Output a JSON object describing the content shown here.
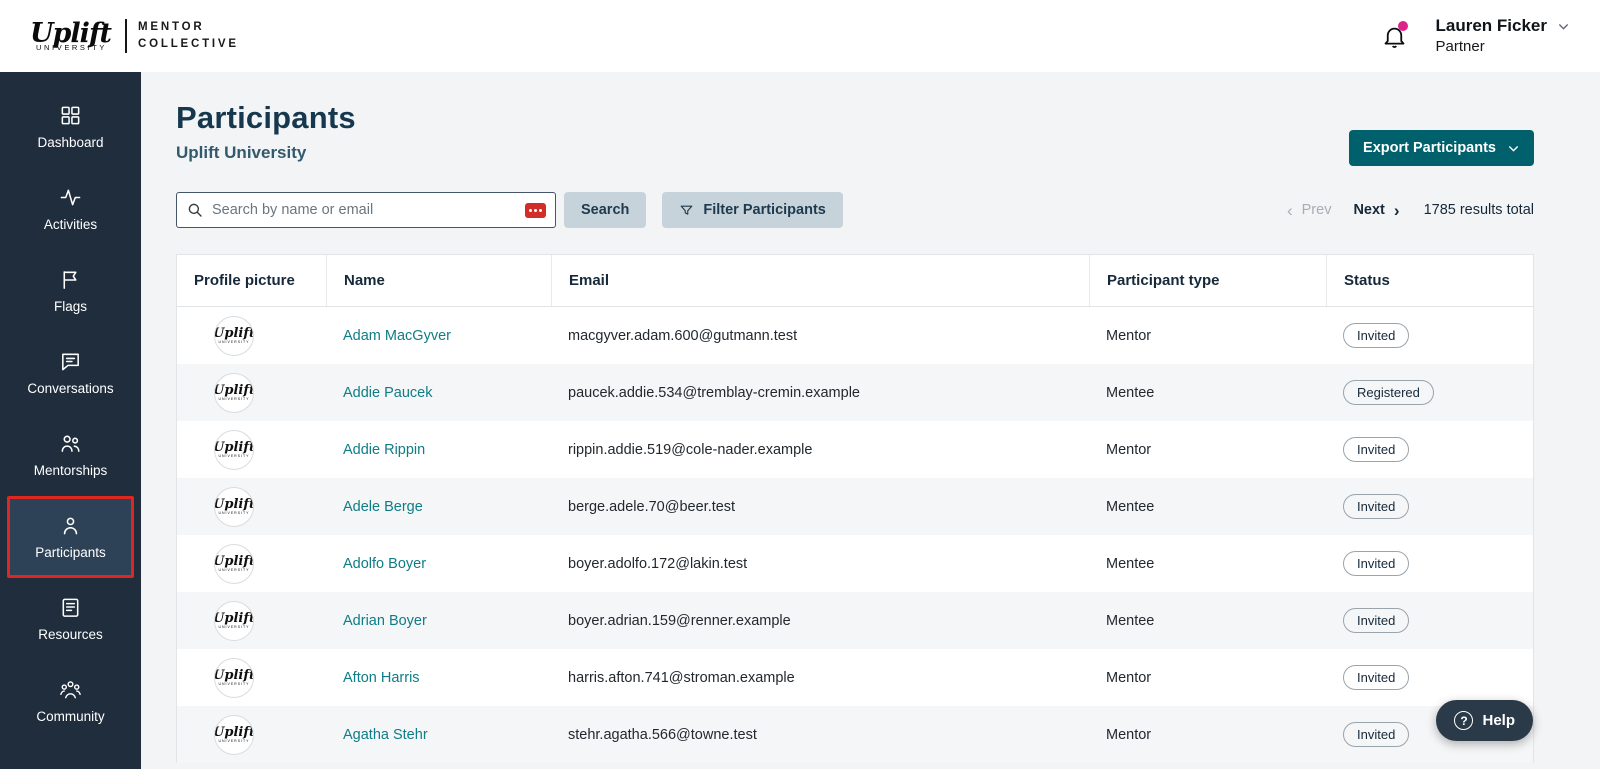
{
  "colors": {
    "sidebar_bg": "#1f2d3d",
    "sidebar_active_bg": "#2d4256",
    "annotation_red": "#df2721",
    "accent_teal": "#00616d",
    "link_teal": "#0e7d85",
    "notification_dot": "#e0218a",
    "title_navy": "#16384e"
  },
  "header": {
    "logo": {
      "brand": "Uplift",
      "brand_sub": "UNIVERSITY",
      "mentor_line1": "MENTOR",
      "mentor_line2": "COLLECTIVE"
    },
    "user": {
      "name": "Lauren Ficker",
      "role": "Partner"
    }
  },
  "sidebar": {
    "items": [
      {
        "label": "Dashboard",
        "icon": "dashboard-icon",
        "active": false
      },
      {
        "label": "Activities",
        "icon": "activities-icon",
        "active": false
      },
      {
        "label": "Flags",
        "icon": "flag-icon",
        "active": false
      },
      {
        "label": "Conversations",
        "icon": "conversations-icon",
        "active": false
      },
      {
        "label": "Mentorships",
        "icon": "mentorships-icon",
        "active": false
      },
      {
        "label": "Participants",
        "icon": "participants-icon",
        "active": true
      },
      {
        "label": "Resources",
        "icon": "resources-icon",
        "active": false
      },
      {
        "label": "Community",
        "icon": "community-icon",
        "active": false
      }
    ]
  },
  "avatar": {
    "brand": "Uplift",
    "sub": "UNIVERSITY"
  },
  "main": {
    "title": "Participants",
    "subtitle": "Uplift University",
    "export_label": "Export Participants",
    "search": {
      "placeholder": "Search by name or email",
      "search_label": "Search",
      "filter_label": "Filter Participants"
    },
    "pagination": {
      "prev_label": "Prev",
      "next_label": "Next",
      "total_label": "1785 results total"
    },
    "table": {
      "columns": [
        "Profile picture",
        "Name",
        "Email",
        "Participant type",
        "Status"
      ],
      "rows": [
        {
          "name": "Adam MacGyver",
          "email": "macgyver.adam.600@gutmann.test",
          "type": "Mentor",
          "status": "Invited"
        },
        {
          "name": "Addie Paucek",
          "email": "paucek.addie.534@tremblay-cremin.example",
          "type": "Mentee",
          "status": "Registered"
        },
        {
          "name": "Addie Rippin",
          "email": "rippin.addie.519@cole-nader.example",
          "type": "Mentor",
          "status": "Invited"
        },
        {
          "name": "Adele Berge",
          "email": "berge.adele.70@beer.test",
          "type": "Mentee",
          "status": "Invited"
        },
        {
          "name": "Adolfo Boyer",
          "email": "boyer.adolfo.172@lakin.test",
          "type": "Mentee",
          "status": "Invited"
        },
        {
          "name": "Adrian Boyer",
          "email": "boyer.adrian.159@renner.example",
          "type": "Mentee",
          "status": "Invited"
        },
        {
          "name": "Afton Harris",
          "email": "harris.afton.741@stroman.example",
          "type": "Mentor",
          "status": "Invited"
        },
        {
          "name": "Agatha Stehr",
          "email": "stehr.agatha.566@towne.test",
          "type": "Mentor",
          "status": "Invited"
        }
      ]
    }
  },
  "help": {
    "label": "Help"
  }
}
